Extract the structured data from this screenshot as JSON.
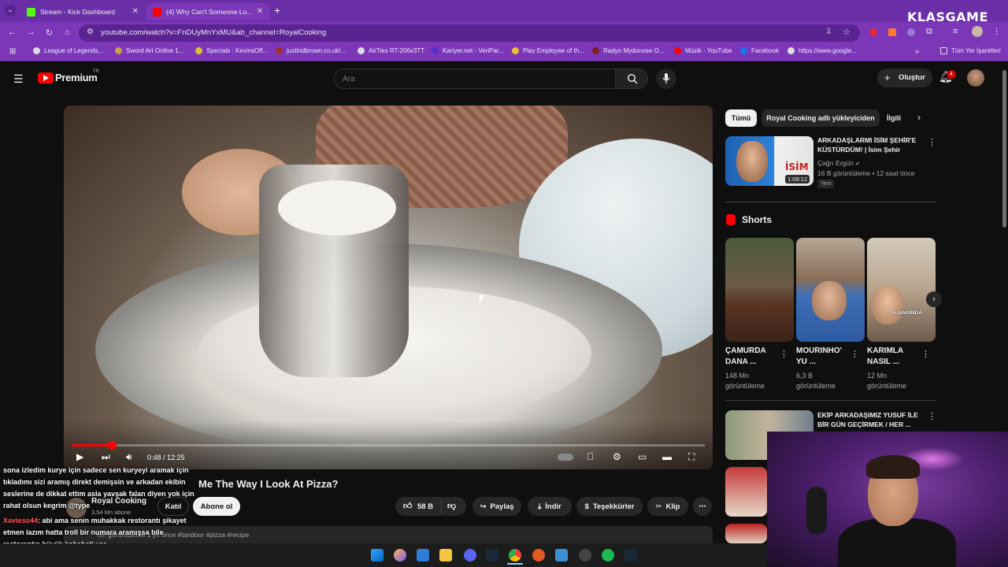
{
  "browser": {
    "tabs": [
      {
        "title": "Stream - Kick Dashboard"
      },
      {
        "title": "(4) Why Can't Someone Lo..."
      }
    ],
    "url": "youtube.com/watch?v=FnDUyMnYxMU&ab_channel=RoyalCooking",
    "bookmarks": [
      "League of Legends...",
      "Sword Art Online 1...",
      "Specials : KevinsOff...",
      "justindbrown.co.uk/...",
      "AirTies RT-206v3TT",
      "Kariyer.net - VeriPar...",
      "Play Employee of th...",
      "Radyo Mydonose O...",
      "Müzik - YouTube",
      "Facebook",
      "https://www.google..."
    ],
    "all_bookmarks": "Tüm Yer İşaretleri",
    "overlay_logo": "KLASGAME"
  },
  "youtube": {
    "logo": "Premium",
    "logo_region": "TR",
    "search_placeholder": "Ara",
    "create_label": "Oluştur",
    "notification_count": "4"
  },
  "video": {
    "time": "0:48 / 12:25",
    "progress_fraction": 0.064,
    "title": "Why Can't Someone Look At Me The Way I Look At Pizza?",
    "title_visible": "Me The Way I Look At Pizza?",
    "channel": "Royal Cooking",
    "subscribers": "3,54 Mn abone",
    "join_label": "Katıl",
    "subscribe_label": "Abone ol",
    "likes": "58 B",
    "share_label": "Paylaş",
    "download_label": "İndir",
    "thanks_label": "Teşekkürler",
    "clip_label": "Klip",
    "description_meta": "Mn görüntüleme  1 yıl önce  #tandoor #pizza #recipe"
  },
  "chat": [
    {
      "text": "sona izledim kurye için sadece sen kuryeyi aramak için"
    },
    {
      "text": "tıkladımı sizi aramış direkt demişsin ve arkadan ekibin"
    },
    {
      "text": "seslerine de dikkat ettim asla yavşak falan diyen yok için"
    },
    {
      "text": "rahat olsun kegrim @type"
    },
    {
      "user": "Xavieso44",
      "text": ": abi ama senin muhakkak restorantı şikayet"
    },
    {
      "text": "etmen lazım hatta troll bir numara aramışsa bile"
    },
    {
      "text": "restorantın büyük kabahati var"
    }
  ],
  "sidebar": {
    "chips": [
      "Tümü",
      "Royal Cooking adlı yükleyiciden",
      "İlgili"
    ],
    "first_video": {
      "title": "ARKADAŞLARMI İSİM ŞEHİR'E KÜSTÜRDÜM! | İsim Şehir",
      "channel": "Çağrı Ergün",
      "meta": "16 B görüntüleme • 12 saat önce",
      "badge": "Yeni",
      "duration": "1:09:12",
      "thumb_text": "İSİM"
    },
    "shorts_heading": "Shorts",
    "shorts": [
      {
        "title": "ÇAMURDA DANA ...",
        "views": "148 Mn görüntüleme"
      },
      {
        "title": "MOURINHO' YU ...",
        "views": "6,3 B görüntüleme"
      },
      {
        "title": "KARIMLA NASIL ...",
        "views": "12 Mn görüntüleme"
      }
    ],
    "next_video": {
      "title": "EKİP ARKADAŞIMIZ YUSUF İLE BİR GÜN GEÇİRMEK / HER ..."
    },
    "short_overlay": "AJANSINDA"
  },
  "colors": {
    "browser_purple": "#7c37b8",
    "tab_purple": "#6a2fa7",
    "yt_red": "#ff0000",
    "yt_bg": "#0f0f0f"
  }
}
